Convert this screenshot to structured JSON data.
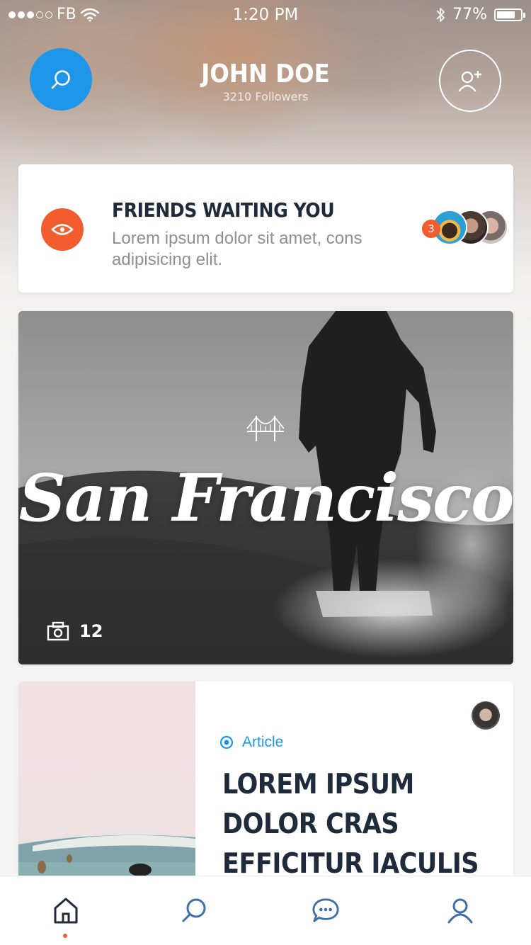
{
  "status_bar": {
    "carrier": "FB",
    "time": "1:20 PM",
    "battery": "77%",
    "battery_level": 0.77
  },
  "header": {
    "name": "JOHN DOE",
    "followers": "3210 Followers",
    "search_icon": "search-icon",
    "add_friend_icon": "add-user-icon"
  },
  "friends_card": {
    "title": "FRIENDS WAITING YOU",
    "description": "Lorem ipsum dolor sit amet, cons adipisicing elit.",
    "badge_count": "3",
    "icon": "eye-icon",
    "accent": "#f25c2f"
  },
  "photo_card": {
    "title": "San Francisco",
    "photo_count": "12",
    "icon": "camera-icon"
  },
  "article_card": {
    "tag": "Article",
    "title": "LOREM IPSUM DOLOR CRAS EFFICITUR IACULIS SAPIEN, VEL",
    "accent": "#1e96ea"
  },
  "tab_bar": {
    "items": [
      {
        "name": "home",
        "icon": "home-icon",
        "active": true
      },
      {
        "name": "search",
        "icon": "search-icon",
        "active": false
      },
      {
        "name": "chat",
        "icon": "chat-icon",
        "active": false
      },
      {
        "name": "profile",
        "icon": "user-icon",
        "active": false
      }
    ]
  }
}
